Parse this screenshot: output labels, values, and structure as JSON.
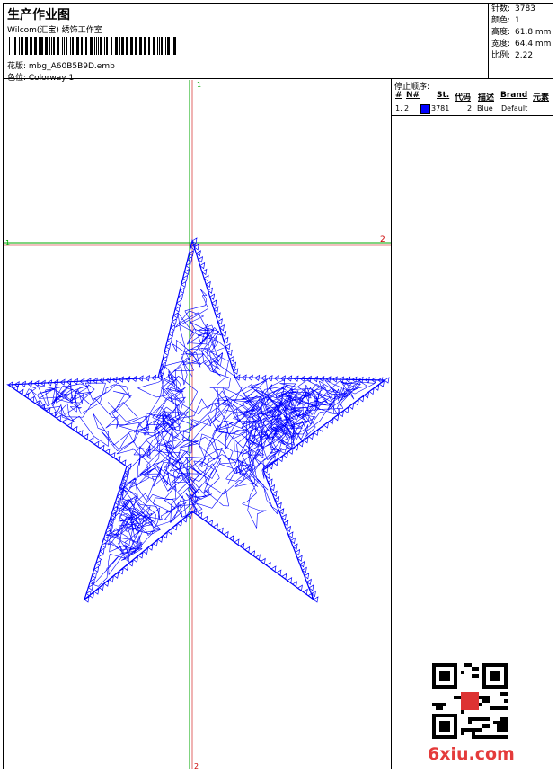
{
  "header": {
    "title": "生产作业图",
    "studio": "Wilcom(汇宝) 绣饰工作室",
    "design": "花版: mbg_A60B5B9D.emb",
    "colorway": "色位: Colorway 1"
  },
  "stats": [
    {
      "label": "针数:",
      "value": "3783"
    },
    {
      "label": "颜色:",
      "value": "1"
    },
    {
      "label": "高度:",
      "value": "61.8 mm"
    },
    {
      "label": "宽度:",
      "value": "64.4 mm"
    },
    {
      "label": "比例:",
      "value": "2.22"
    }
  ],
  "thread_table": {
    "title": "停止顺序:",
    "headers": {
      "hash": "#",
      "no": "N#",
      "st": "St.",
      "code": "代码",
      "desc": "描述",
      "brand": "Brand",
      "elem": "元素"
    },
    "rows": [
      {
        "index": "1.",
        "no": "2",
        "swatch_color": "#0000ff",
        "stitches": "3781",
        "code": "2",
        "desc": "Blue",
        "brand": "Default"
      }
    ]
  },
  "canvas": {
    "guide_v_top": "1",
    "guide_v_bottom": "2",
    "guide_h_left": "1",
    "guide_h_right": "2",
    "stitch_color": "#0000ff",
    "guide_green": "#00aa00",
    "guide_red": "#cc0000"
  },
  "watermark": "6xiu.com"
}
